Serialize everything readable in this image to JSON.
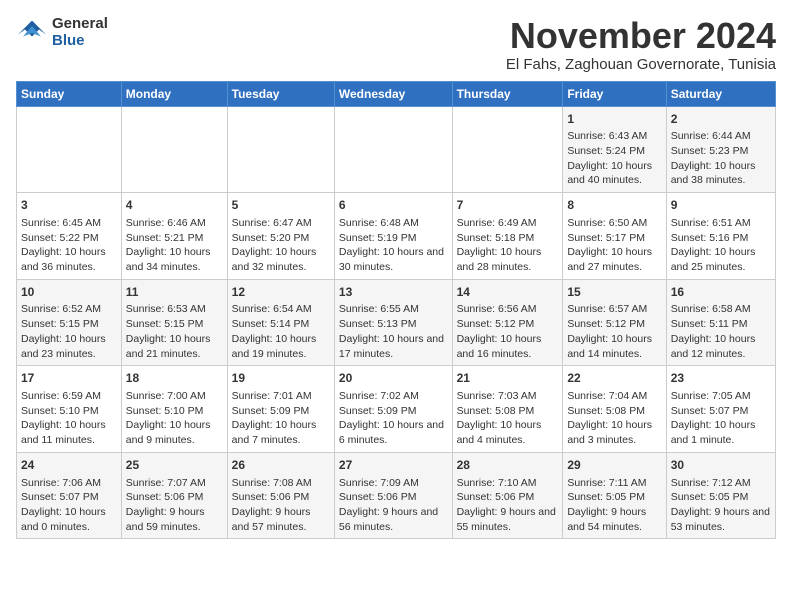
{
  "logo": {
    "general": "General",
    "blue": "Blue"
  },
  "header": {
    "month": "November 2024",
    "location": "El Fahs, Zaghouan Governorate, Tunisia"
  },
  "weekdays": [
    "Sunday",
    "Monday",
    "Tuesday",
    "Wednesday",
    "Thursday",
    "Friday",
    "Saturday"
  ],
  "weeks": [
    [
      {
        "day": "",
        "info": ""
      },
      {
        "day": "",
        "info": ""
      },
      {
        "day": "",
        "info": ""
      },
      {
        "day": "",
        "info": ""
      },
      {
        "day": "",
        "info": ""
      },
      {
        "day": "1",
        "info": "Sunrise: 6:43 AM\nSunset: 5:24 PM\nDaylight: 10 hours and 40 minutes."
      },
      {
        "day": "2",
        "info": "Sunrise: 6:44 AM\nSunset: 5:23 PM\nDaylight: 10 hours and 38 minutes."
      }
    ],
    [
      {
        "day": "3",
        "info": "Sunrise: 6:45 AM\nSunset: 5:22 PM\nDaylight: 10 hours and 36 minutes."
      },
      {
        "day": "4",
        "info": "Sunrise: 6:46 AM\nSunset: 5:21 PM\nDaylight: 10 hours and 34 minutes."
      },
      {
        "day": "5",
        "info": "Sunrise: 6:47 AM\nSunset: 5:20 PM\nDaylight: 10 hours and 32 minutes."
      },
      {
        "day": "6",
        "info": "Sunrise: 6:48 AM\nSunset: 5:19 PM\nDaylight: 10 hours and 30 minutes."
      },
      {
        "day": "7",
        "info": "Sunrise: 6:49 AM\nSunset: 5:18 PM\nDaylight: 10 hours and 28 minutes."
      },
      {
        "day": "8",
        "info": "Sunrise: 6:50 AM\nSunset: 5:17 PM\nDaylight: 10 hours and 27 minutes."
      },
      {
        "day": "9",
        "info": "Sunrise: 6:51 AM\nSunset: 5:16 PM\nDaylight: 10 hours and 25 minutes."
      }
    ],
    [
      {
        "day": "10",
        "info": "Sunrise: 6:52 AM\nSunset: 5:15 PM\nDaylight: 10 hours and 23 minutes."
      },
      {
        "day": "11",
        "info": "Sunrise: 6:53 AM\nSunset: 5:15 PM\nDaylight: 10 hours and 21 minutes."
      },
      {
        "day": "12",
        "info": "Sunrise: 6:54 AM\nSunset: 5:14 PM\nDaylight: 10 hours and 19 minutes."
      },
      {
        "day": "13",
        "info": "Sunrise: 6:55 AM\nSunset: 5:13 PM\nDaylight: 10 hours and 17 minutes."
      },
      {
        "day": "14",
        "info": "Sunrise: 6:56 AM\nSunset: 5:12 PM\nDaylight: 10 hours and 16 minutes."
      },
      {
        "day": "15",
        "info": "Sunrise: 6:57 AM\nSunset: 5:12 PM\nDaylight: 10 hours and 14 minutes."
      },
      {
        "day": "16",
        "info": "Sunrise: 6:58 AM\nSunset: 5:11 PM\nDaylight: 10 hours and 12 minutes."
      }
    ],
    [
      {
        "day": "17",
        "info": "Sunrise: 6:59 AM\nSunset: 5:10 PM\nDaylight: 10 hours and 11 minutes."
      },
      {
        "day": "18",
        "info": "Sunrise: 7:00 AM\nSunset: 5:10 PM\nDaylight: 10 hours and 9 minutes."
      },
      {
        "day": "19",
        "info": "Sunrise: 7:01 AM\nSunset: 5:09 PM\nDaylight: 10 hours and 7 minutes."
      },
      {
        "day": "20",
        "info": "Sunrise: 7:02 AM\nSunset: 5:09 PM\nDaylight: 10 hours and 6 minutes."
      },
      {
        "day": "21",
        "info": "Sunrise: 7:03 AM\nSunset: 5:08 PM\nDaylight: 10 hours and 4 minutes."
      },
      {
        "day": "22",
        "info": "Sunrise: 7:04 AM\nSunset: 5:08 PM\nDaylight: 10 hours and 3 minutes."
      },
      {
        "day": "23",
        "info": "Sunrise: 7:05 AM\nSunset: 5:07 PM\nDaylight: 10 hours and 1 minute."
      }
    ],
    [
      {
        "day": "24",
        "info": "Sunrise: 7:06 AM\nSunset: 5:07 PM\nDaylight: 10 hours and 0 minutes."
      },
      {
        "day": "25",
        "info": "Sunrise: 7:07 AM\nSunset: 5:06 PM\nDaylight: 9 hours and 59 minutes."
      },
      {
        "day": "26",
        "info": "Sunrise: 7:08 AM\nSunset: 5:06 PM\nDaylight: 9 hours and 57 minutes."
      },
      {
        "day": "27",
        "info": "Sunrise: 7:09 AM\nSunset: 5:06 PM\nDaylight: 9 hours and 56 minutes."
      },
      {
        "day": "28",
        "info": "Sunrise: 7:10 AM\nSunset: 5:06 PM\nDaylight: 9 hours and 55 minutes."
      },
      {
        "day": "29",
        "info": "Sunrise: 7:11 AM\nSunset: 5:05 PM\nDaylight: 9 hours and 54 minutes."
      },
      {
        "day": "30",
        "info": "Sunrise: 7:12 AM\nSunset: 5:05 PM\nDaylight: 9 hours and 53 minutes."
      }
    ]
  ]
}
